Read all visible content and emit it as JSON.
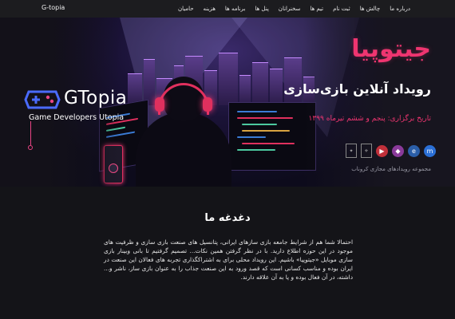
{
  "navbar": {
    "brand": "G-topia",
    "items": [
      "درباره ما",
      "چالش ها",
      "ثبت نام",
      "تیم ها",
      "سخنرانان",
      "پنل ها",
      "برنامه ها",
      "هزینه",
      "حامیان"
    ]
  },
  "hero": {
    "title": "جیتوپیا",
    "subtitle": "رویداد آنلاین بازی‌سازی",
    "date": "تاریخ برگزاری: پنجم و ششم تیرماه ۱۳۹۹",
    "logo": {
      "name": "GTopia",
      "tagline": "Game Developers Utopia"
    },
    "partners_caption": "مجموعه رویدادهای مجازی کرونا‌ب",
    "partner_icons": [
      "m-logo-icon",
      "ec-logo-icon",
      "game-logo-icon",
      "arrow-logo-icon",
      "emblem-icon",
      "ministry-emblem-icon"
    ]
  },
  "content": {
    "heading": "دغدغه ما",
    "paragraph": "احتمالا شما هم از شرایط جامعه بازی سازهای ایرانی، پتانسیل های صنعت بازی سازی و ظرفیت های موجود در این حوزه اطلاع دارید. با در نظر گرفتن همین نکات... تصمیم گرفتیم تا بانی وبینار بازی سازی موبایل «جیتوپیا» باشیم. این رویداد محلی برای به اشتراکگذاری تجربه های فعالان این صنعت در ایران بوده و مناسب کسانی است که قصد ورود به این صنعت جذاب را به عنوان بازی ساز، ناشر و... داشته، در آن فعال بوده و یا به آن علاقه دارند."
  },
  "colors": {
    "accent": "#ef3570",
    "background": "#141418",
    "navbar": "#1c1c1f"
  }
}
